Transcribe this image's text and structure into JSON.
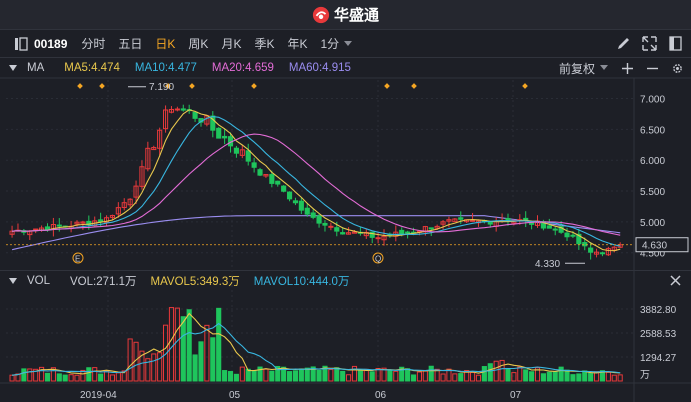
{
  "brand": {
    "name": "华盛通"
  },
  "toolbar": {
    "code": "00189",
    "periods": [
      "分时",
      "五日",
      "日K",
      "周K",
      "月K",
      "季K",
      "年K"
    ],
    "active_period": "日K",
    "interval": "1分"
  },
  "ma_bar": {
    "label": "MA",
    "ma5": "MA5:4.474",
    "ma10": "MA10:4.477",
    "ma20": "MA20:4.659",
    "ma60": "MA60:4.915",
    "adjust": "前复权"
  },
  "vol_bar": {
    "label": "VOL",
    "vol": "VOL:271.1万",
    "mavol5": "MAVOL5:349.3万",
    "mavol10": "MAVOL10:444.0万"
  },
  "colors": {
    "up": "#e8393b",
    "down": "#1fc55c",
    "ma5": "#e9c84d",
    "ma10": "#38b6e0",
    "ma20": "#e36cd6",
    "ma60": "#9a8df0",
    "accent": "#f5a623"
  },
  "chart_data": [
    {
      "type": "candlestick",
      "y_ticks": [
        "7.000",
        "6.500",
        "6.000",
        "5.500",
        "5.000",
        "4.500"
      ],
      "ylim": [
        4.35,
        7.3
      ],
      "last_price": "4.630",
      "high_label": "7.190",
      "low_label": "4.330",
      "markers": [
        "E",
        "Q"
      ],
      "x_dates": [
        "2019-04",
        "05",
        "06",
        "07"
      ]
    },
    {
      "type": "bar",
      "y_ticks": [
        "3882.80",
        "2588.53",
        "1294.27"
      ],
      "unit": "万",
      "ylim": [
        0,
        4800
      ]
    }
  ]
}
